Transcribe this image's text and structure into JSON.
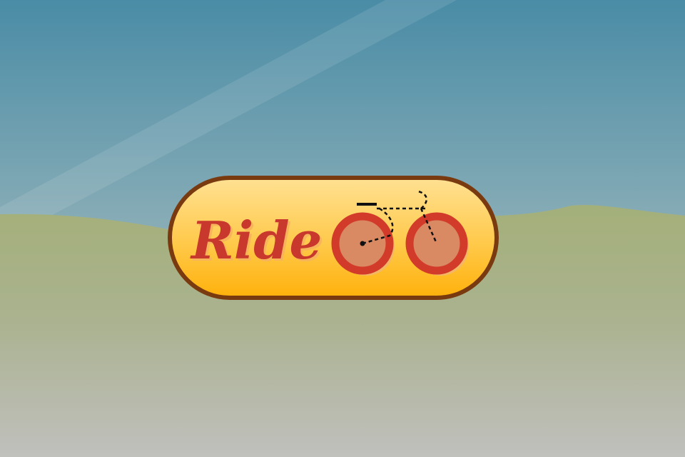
{
  "splash": {
    "logo_text": "Ride",
    "colors": {
      "sky_top": "#4e8ea5",
      "sky_horizon": "#c2c3c2",
      "hill_top": "#a5b27d",
      "ground_bottom": "#bfbfbc",
      "badge_border": "#7a3a10",
      "badge_fill_top": "#ffe08f",
      "badge_fill_bottom": "#ffb20a",
      "text": "#c8382d",
      "wheel_ring": "#d23a2a",
      "wheel_hub": "#d98a63",
      "wheel_shadow": "#f3b765",
      "frame": "#111111"
    },
    "icons": {
      "bicycle": "bicycle-icon"
    }
  }
}
